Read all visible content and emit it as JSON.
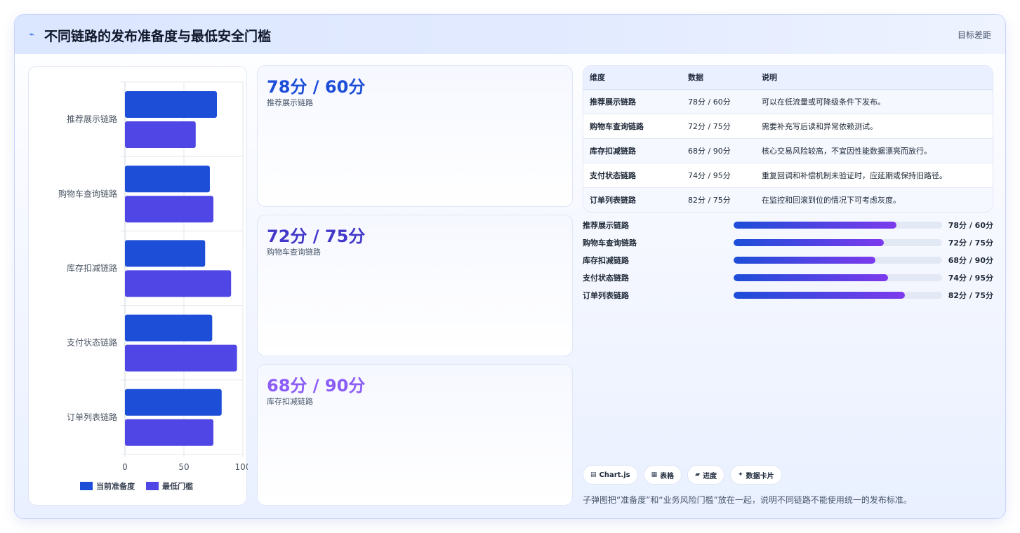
{
  "header": {
    "logo_icon": "bolt-icon",
    "title": "不同链路的发布准备度与最低安全门槛",
    "goal_label": "目标差距"
  },
  "chart_data": {
    "type": "bar",
    "orientation": "horizontal",
    "categories": [
      "推荐展示链路",
      "购物车查询链路",
      "库存扣减链路",
      "支付状态链路",
      "订单列表链路"
    ],
    "series": [
      {
        "name": "当前准备度",
        "values": [
          78,
          72,
          68,
          74,
          82
        ],
        "color": "#1d4ed8"
      },
      {
        "name": "最低门槛",
        "values": [
          60,
          75,
          90,
          95,
          75
        ],
        "color": "#4f46e5"
      }
    ],
    "xlim": [
      0,
      100
    ],
    "x_ticks": [
      "0",
      "50",
      "100"
    ],
    "grid": true,
    "legend_position": "bottom"
  },
  "stat_cards": [
    {
      "value": "78分 / 60分",
      "label": "推荐展示链路",
      "color": "#1d4ed8"
    },
    {
      "value": "72分 / 75分",
      "label": "购物车查询链路",
      "color": "#4338ca"
    },
    {
      "value": "68分 / 90分",
      "label": "库存扣减链路",
      "color": "#8b5cf6"
    }
  ],
  "table": {
    "headers": [
      "维度",
      "数据",
      "说明"
    ],
    "rows": [
      [
        "推荐展示链路",
        "78分 / 60分",
        "可以在低流量或可降级条件下发布。"
      ],
      [
        "购物车查询链路",
        "72分 / 75分",
        "需要补充写后读和异常依赖测试。"
      ],
      [
        "库存扣减链路",
        "68分 / 90分",
        "核心交易风险较高，不宜因性能数据漂亮而放行。"
      ],
      [
        "支付状态链路",
        "74分 / 95分",
        "重复回调和补偿机制未验证时，应延期或保持旧路径。"
      ],
      [
        "订单列表链路",
        "82分 / 75分",
        "在监控和回滚到位的情况下可考虑灰度。"
      ]
    ]
  },
  "progress": [
    {
      "name": "推荐展示链路",
      "value_text": "78分 / 60分",
      "fraction": 0.78
    },
    {
      "name": "购物车查询链路",
      "value_text": "72分 / 75分",
      "fraction": 0.72
    },
    {
      "name": "库存扣减链路",
      "value_text": "68分 / 90分",
      "fraction": 0.68
    },
    {
      "name": "支付状态链路",
      "value_text": "74分 / 95分",
      "fraction": 0.74
    },
    {
      "name": "订单列表链路",
      "value_text": "82分 / 75分",
      "fraction": 0.82
    }
  ],
  "tags": [
    {
      "icon": "chart-icon",
      "glyph": "▤",
      "label": "Chart.js"
    },
    {
      "icon": "table-icon",
      "glyph": "▦",
      "label": "表格"
    },
    {
      "icon": "progress-icon",
      "glyph": "▰",
      "label": "进度"
    },
    {
      "icon": "sparkle-icon",
      "glyph": "✦",
      "label": "数据卡片"
    }
  ],
  "footnote": "子弹图把“准备度”和“业务风险门槛”放在一起，说明不同链路不能使用统一的发布标准。"
}
